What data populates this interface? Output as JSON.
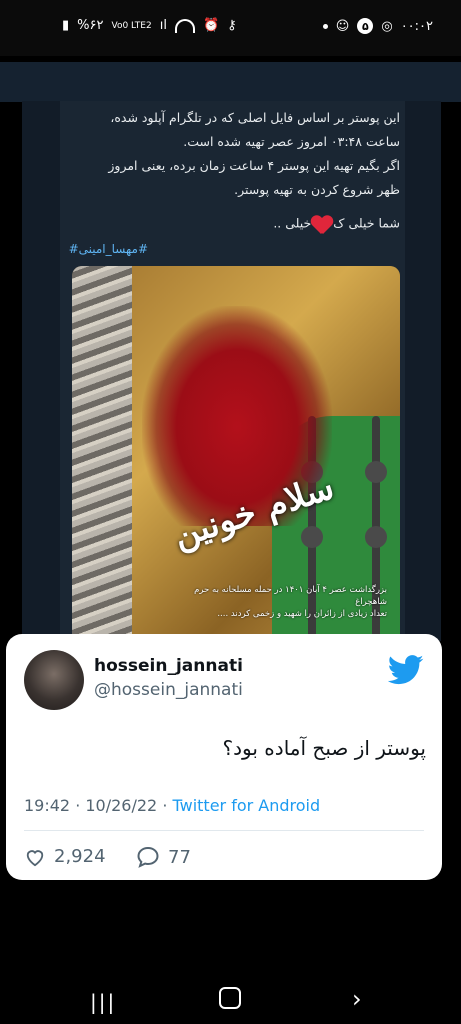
{
  "status_bar": {
    "battery": "%۶۲",
    "network": "Vo0 LTE2",
    "badge_count": "۵",
    "time": "۰۰:۰۲"
  },
  "post": {
    "text_lines": [
      "این پوستر بر اساس فایل اصلی که در تلگرام آپلود شده،",
      "ساعت ۰۳:۴۸ امروز عصر تهیه شده است.",
      "اگر بگیم تهیه این پوستر ۴ ساعت زمان برده، یعنی امروز",
      "ظهر شروع کردن به تهیه پوستر."
    ],
    "line2_a": "شما خیلی ک",
    "line2_b": "خیلی ..",
    "hashtag": "#مهسا_امینی#"
  },
  "poster": {
    "title": "سلام خونین",
    "caption_line1": "بزرگداشت عصر ۴ آبان ۱۴۰۱ در حمله مسلحانه به حرم شاهچراغ",
    "caption_line2": "تعداد زیادی از زائران را شهید و زخمی کردند ...."
  },
  "tweet": {
    "display_name": "hossein_jannati",
    "handle": "@hossein_jannati",
    "text": "پوستر از صبح آماده بود؟",
    "time_date": "19:42 · 10/26/22 · ",
    "source": "Twitter for Android",
    "likes": "2,924",
    "replies": "77"
  },
  "nav": {
    "recent": "|||",
    "back": "›"
  }
}
